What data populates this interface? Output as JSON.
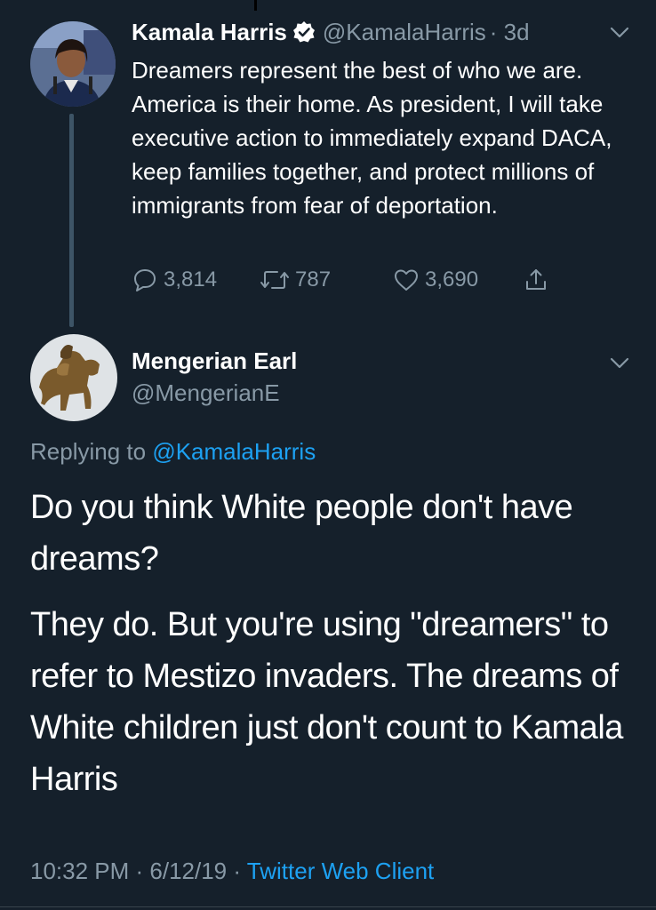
{
  "original_tweet": {
    "display_name": "Kamala Harris",
    "handle": "@KamalaHarris",
    "time": "· 3d",
    "text": "Dreamers represent the best of who we are. America is their home. As president, I will take executive action to immediately expand DACA, keep families together, and protect millions of immigrants from fear of deportation.",
    "replies": "3,814",
    "retweets": "787",
    "likes": "3,690",
    "icons": [
      "verified-badge-icon",
      "chevron-down-icon",
      "reply-icon",
      "retweet-icon",
      "like-icon",
      "share-icon"
    ]
  },
  "reply_tweet": {
    "display_name": "Mengerian Earl",
    "handle": "@MengerianE",
    "replying_prefix": "Replying to",
    "replying_to": "@KamalaHarris",
    "paragraph_1": "Do you think White people don't have dreams?",
    "paragraph_2": "They do. But you're using \"dreamers\" to refer to Mestizo invaders. The dreams of White children just don't count to Kamala Harris",
    "timestamp": "10:32 PM · 6/12/19 ·",
    "client": "Twitter Web Client"
  },
  "colors": {
    "background": "#15202b",
    "muted": "#8899a6",
    "link": "#1da1f2",
    "thread_line": "#3d5466"
  }
}
